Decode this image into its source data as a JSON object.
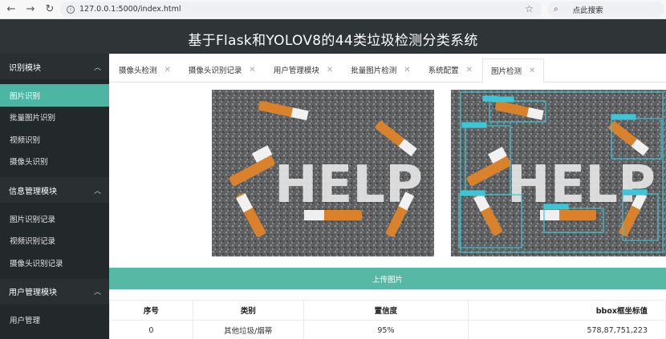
{
  "browser": {
    "url": "127.0.0.1:5000/index.html",
    "search_placeholder": "点此搜索"
  },
  "header": {
    "title": "基于Flask和YOLOV8的44类垃圾检测分类系统"
  },
  "sidebar": {
    "sections": [
      {
        "title": "识别模块",
        "items": [
          "图片识别",
          "批量图片识别",
          "视频识别",
          "摄像头识别"
        ]
      },
      {
        "title": "信息管理模块",
        "items": [
          "图片识别记录",
          "视频识别记录",
          "摄像头识别记录"
        ]
      },
      {
        "title": "用户管理模块",
        "items": [
          "用户管理"
        ]
      }
    ],
    "active_item": "图片识别"
  },
  "tabs": [
    "摄像头检测",
    "摄像头识别记录",
    "用户管理模块",
    "批量图片检测",
    "系统配置",
    "图片检测"
  ],
  "active_tab": "图片检测",
  "image_text": "HELP",
  "detections": [
    {
      "label": "其他垃圾/烟蒂",
      "score": "0.95"
    }
  ],
  "upload_label": "上传图片",
  "table": {
    "headers": [
      "序号",
      "类别",
      "置信度",
      "bbox框坐标值"
    ],
    "rows": [
      [
        "0",
        "其他垃圾/烟蒂",
        "95%",
        "578,87,751,223"
      ]
    ]
  },
  "colors": {
    "accent": "#56b8a5",
    "header_bg": "#2f3437",
    "sidebar_bg": "#23282b",
    "bbox": "#3fc6d6"
  }
}
